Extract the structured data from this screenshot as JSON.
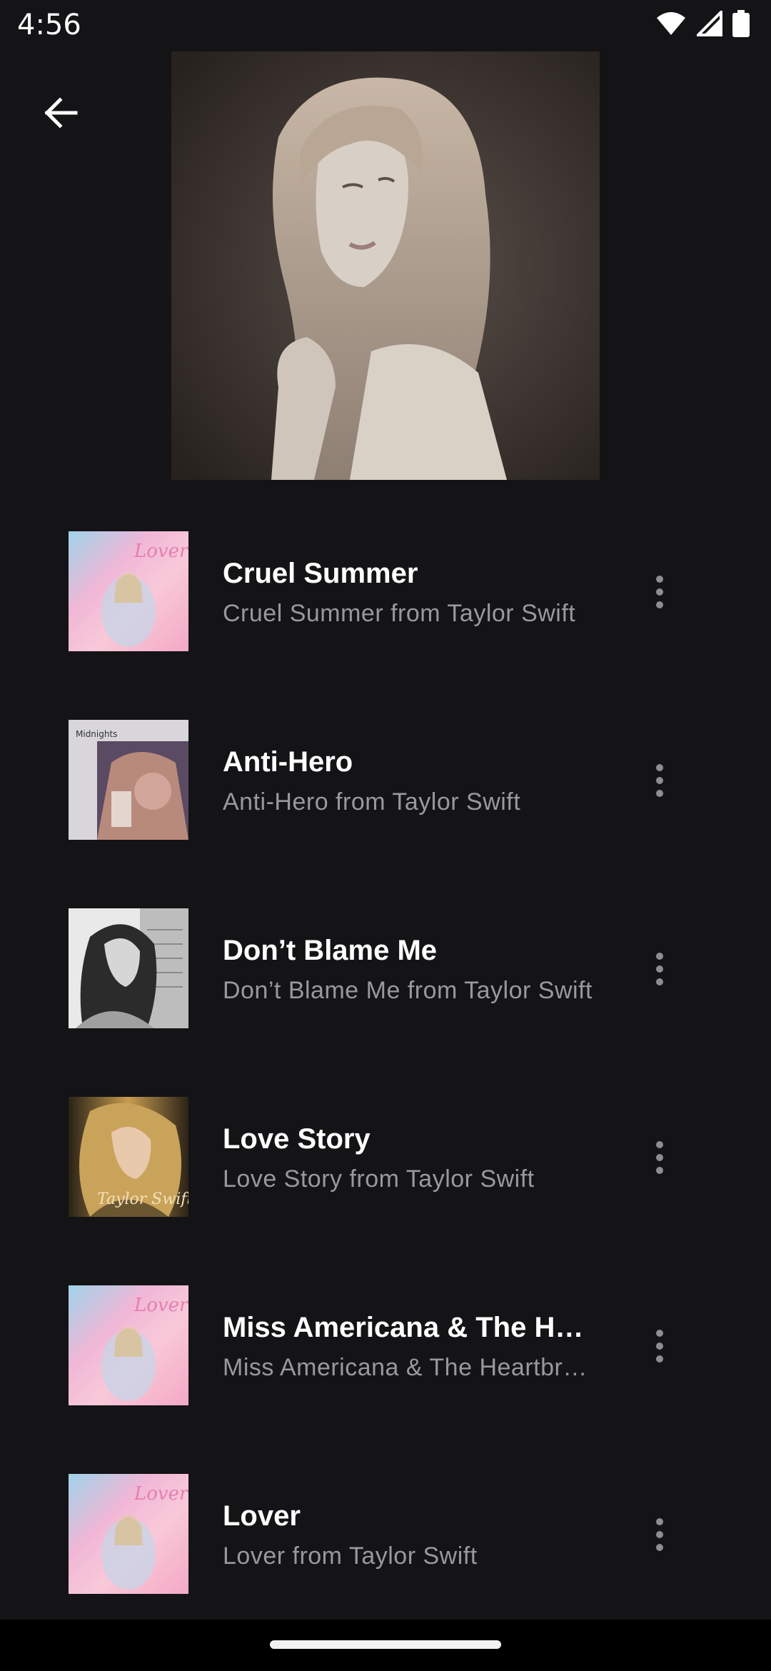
{
  "status_bar": {
    "time": "4:56",
    "icons": [
      "wifi-icon",
      "signal-icon",
      "battery-icon"
    ]
  },
  "header": {
    "back_icon": "arrow-left-icon",
    "hero_art": "album-cover-tortured-poets"
  },
  "songs": [
    {
      "title": "Cruel Summer",
      "subtitle": "Cruel Summer from Taylor Swift",
      "art": "lover-cover"
    },
    {
      "title": "Anti-Hero",
      "subtitle": "Anti-Hero from Taylor Swift",
      "art": "midnights-cover"
    },
    {
      "title": "Don’t Blame Me",
      "subtitle": "Don’t Blame Me from Taylor Swift",
      "art": "reputation-cover"
    },
    {
      "title": "Love Story",
      "subtitle": "Love Story from Taylor Swift",
      "art": "fearless-cover"
    },
    {
      "title": "Miss Americana & The Heartbreak Prince",
      "subtitle": "Miss Americana & The Heartbreak Prince from Taylor Swift",
      "art": "lover-cover"
    },
    {
      "title": "Lover",
      "subtitle": "Lover from Taylor Swift",
      "art": "lover-cover"
    }
  ],
  "colors": {
    "background": "#141316",
    "title": "#ffffff",
    "subtitle": "#9a989d",
    "overflow_icon": "#8f8d92"
  }
}
